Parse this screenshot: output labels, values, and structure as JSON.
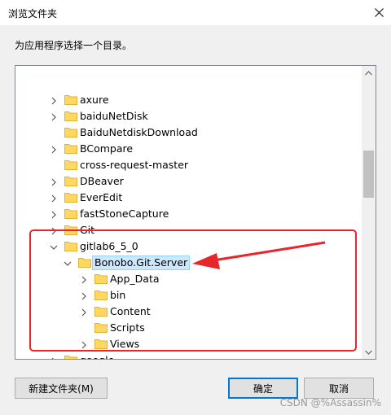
{
  "window": {
    "title": "浏览文件夹",
    "close_label": "✕"
  },
  "description": "为应用程序选择一个目录。",
  "tree": {
    "items": [
      {
        "label": "axure",
        "chevron": "right",
        "level": 1
      },
      {
        "label": "baiduNetDisk",
        "chevron": "right",
        "level": 1
      },
      {
        "label": "BaiduNetdiskDownload",
        "chevron": "none",
        "level": 1
      },
      {
        "label": "BCompare",
        "chevron": "right",
        "level": 1
      },
      {
        "label": "cross-request-master",
        "chevron": "none",
        "level": 1
      },
      {
        "label": "DBeaver",
        "chevron": "right",
        "level": 1
      },
      {
        "label": "EverEdit",
        "chevron": "right",
        "level": 1
      },
      {
        "label": "fastStoneCapture",
        "chevron": "right",
        "level": 1
      },
      {
        "label": "Git",
        "chevron": "right",
        "level": 1
      },
      {
        "label": "gitlab6_5_0",
        "chevron": "down",
        "level": 1
      },
      {
        "label": "Bonobo.Git.Server",
        "chevron": "down",
        "level": 2,
        "selected": true
      },
      {
        "label": "App_Data",
        "chevron": "right",
        "level": 3
      },
      {
        "label": "bin",
        "chevron": "right",
        "level": 3
      },
      {
        "label": "Content",
        "chevron": "right",
        "level": 3
      },
      {
        "label": "Scripts",
        "chevron": "none",
        "level": 3
      },
      {
        "label": "Views",
        "chevron": "right",
        "level": 3
      },
      {
        "label": "google",
        "chevron": "right",
        "level": 1
      }
    ]
  },
  "buttons": {
    "new_folder": "新建文件夹(M)",
    "ok": "确定",
    "cancel": "取消"
  },
  "watermark": "CSDN @%Assassin%",
  "colors": {
    "annotation_red": "#e8262a",
    "folder_yellow": "#ffd862",
    "selection_bg": "#cce8ff"
  }
}
